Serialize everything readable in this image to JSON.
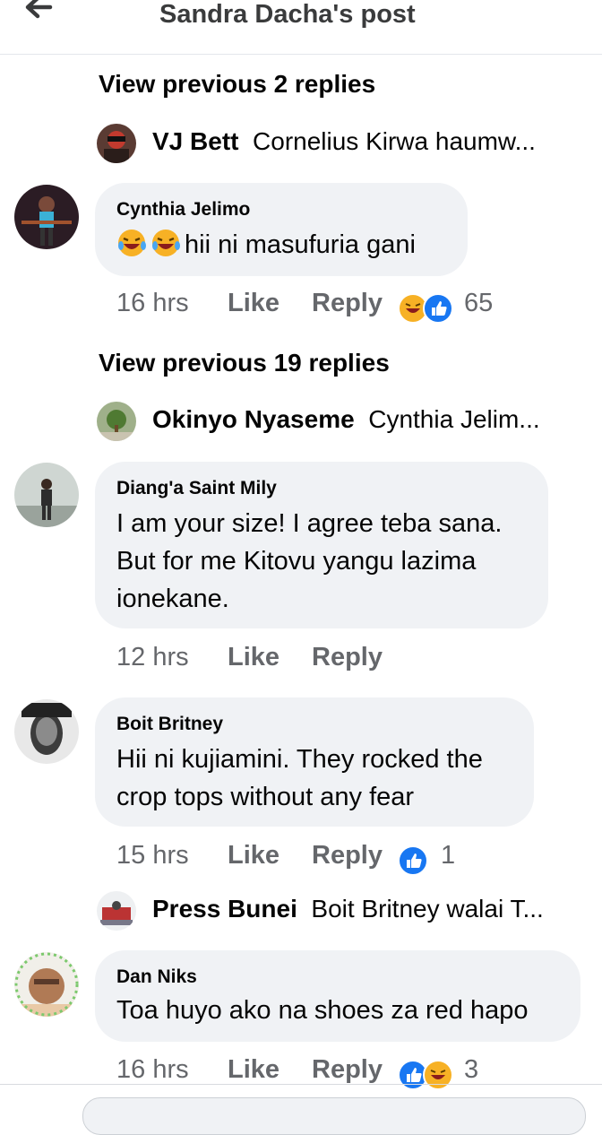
{
  "header": {
    "title": "Sandra Dacha's post"
  },
  "thread1": {
    "view_previous": "View previous 2 replies",
    "preview": {
      "name": "VJ Bett",
      "text": "Cornelius Kirwa haumw..."
    }
  },
  "comment_cynthia": {
    "author": "Cynthia Jelimo",
    "text": "hii ni masufuria gani",
    "time": "16 hrs",
    "like": "Like",
    "reply": "Reply",
    "reaction_count": "65",
    "reactions": [
      "haha-icon",
      "like-icon"
    ]
  },
  "thread2": {
    "view_previous": "View previous 19 replies",
    "preview": {
      "name": "Okinyo Nyaseme",
      "text": "Cynthia Jelim..."
    }
  },
  "comment_diang": {
    "author": "Diang'a Saint Mily",
    "lines": [
      "I am your size! I agree teba sana.",
      "But for me Kitovu yangu lazima",
      "ionekane."
    ],
    "time": "12 hrs",
    "like": "Like",
    "reply": "Reply"
  },
  "comment_boit": {
    "author": "Boit Britney",
    "lines": [
      "Hii ni kujiamini. They rocked the",
      "crop tops without any fear"
    ],
    "time": "15 hrs",
    "like": "Like",
    "reply": "Reply",
    "reaction_count": "1",
    "reactions": [
      "like-icon"
    ]
  },
  "thread3": {
    "preview": {
      "name": "Press Bunei",
      "text": "Boit Britney walai T..."
    }
  },
  "comment_dan": {
    "author": "Dan Niks",
    "text": "Toa huyo ako na shoes za red hapo",
    "time": "16 hrs",
    "like": "Like",
    "reply": "Reply",
    "reaction_count": "3",
    "reactions": [
      "like-icon",
      "haha-icon"
    ]
  },
  "colors": {
    "like_blue": "#1877f2",
    "haha_yellow": "#f7b125",
    "bubble_gray": "#f0f2f5",
    "meta_gray": "#65676b"
  }
}
